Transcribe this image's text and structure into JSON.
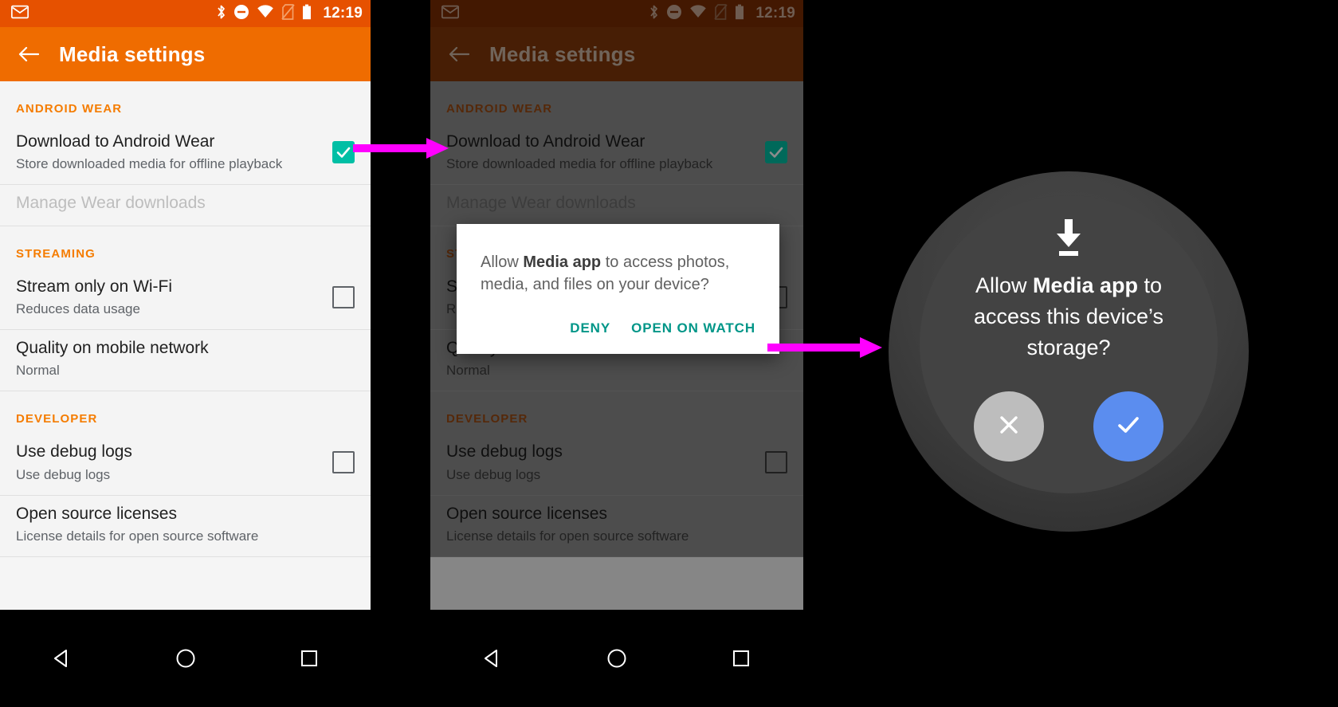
{
  "status_bar": {
    "time": "12:19",
    "icons": [
      "gmail-icon",
      "bluetooth-icon",
      "do-not-disturb-icon",
      "wifi-icon",
      "no-sim-icon",
      "battery-icon"
    ]
  },
  "app_bar": {
    "title": "Media settings",
    "back_icon": "back-arrow-icon"
  },
  "settings": {
    "sections": [
      {
        "header": "ANDROID WEAR",
        "rows": [
          {
            "title": "Download to Android Wear",
            "subtitle": "Store downloaded media for offline playback",
            "control": "checkbox",
            "checked": true,
            "disabled": false
          },
          {
            "title": "Manage Wear downloads",
            "subtitle": "",
            "control": "none",
            "checked": false,
            "disabled": true
          }
        ]
      },
      {
        "header": "STREAMING",
        "rows": [
          {
            "title": "Stream only on Wi-Fi",
            "subtitle": "Reduces data usage",
            "control": "checkbox",
            "checked": false,
            "disabled": false
          },
          {
            "title": "Quality on mobile network",
            "subtitle": "Normal",
            "control": "none",
            "checked": false,
            "disabled": false
          }
        ]
      },
      {
        "header": "DEVELOPER",
        "rows": [
          {
            "title": "Use debug logs",
            "subtitle": "Use debug logs",
            "control": "checkbox",
            "checked": false,
            "disabled": false
          },
          {
            "title": "Open source licenses",
            "subtitle": "License details for open source software",
            "control": "none",
            "checked": false,
            "disabled": false
          }
        ]
      }
    ]
  },
  "dialog": {
    "message_prefix": "Allow ",
    "message_app": "Media app",
    "message_suffix": " to access photos, media, and files on your device?",
    "deny_label": "DENY",
    "confirm_label": "OPEN ON WATCH"
  },
  "watch": {
    "icon": "download-icon",
    "text_prefix": "Allow ",
    "text_app": "Media app",
    "text_suffix": "  to access this device’s storage?",
    "deny_icon": "close-icon",
    "allow_icon": "check-icon"
  },
  "nav_bar": {
    "items": [
      "back-triangle-icon",
      "home-circle-icon",
      "recents-square-icon"
    ]
  },
  "colors": {
    "status_bar": "#e65100",
    "app_bar": "#ef6c00",
    "section_header": "#f57c00",
    "checkbox_checked": "#00bfa5",
    "dialog_action": "#009688",
    "watch_allow": "#5b8def",
    "watch_deny": "#bdbdbd",
    "arrow": "#ff00ff"
  }
}
